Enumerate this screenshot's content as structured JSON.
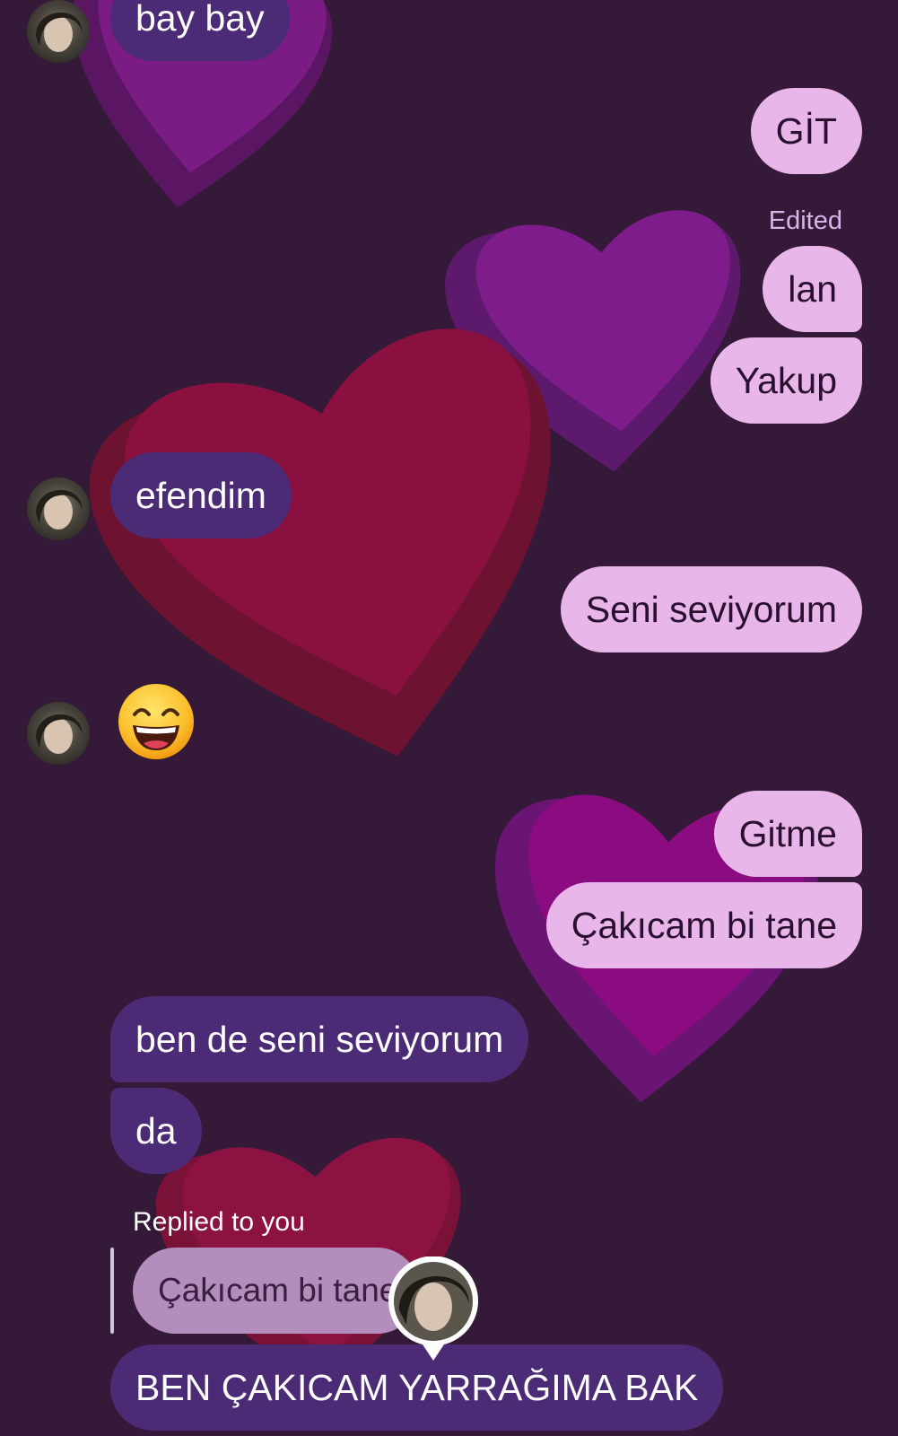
{
  "chat": {
    "messages": [
      {
        "id": "m1",
        "direction": "incoming",
        "text": "bay bay"
      },
      {
        "id": "m2",
        "direction": "outgoing",
        "text": "GİT"
      },
      {
        "id": "m3",
        "direction": "outgoing",
        "text": "lan",
        "edited_label": "Edited"
      },
      {
        "id": "m4",
        "direction": "outgoing",
        "text": "Yakup"
      },
      {
        "id": "m5",
        "direction": "incoming",
        "text": "efendim"
      },
      {
        "id": "m6",
        "direction": "outgoing",
        "text": "Seni seviyorum"
      },
      {
        "id": "m7",
        "direction": "incoming",
        "emoji": "grinning-face-with-smiling-eyes"
      },
      {
        "id": "m8",
        "direction": "outgoing",
        "text": "Gitme"
      },
      {
        "id": "m9",
        "direction": "outgoing",
        "text": "Çakıcam bi tane"
      },
      {
        "id": "m10",
        "direction": "incoming",
        "text": "ben de seni seviyorum"
      },
      {
        "id": "m11",
        "direction": "incoming",
        "text": "da"
      },
      {
        "id": "m12",
        "direction": "incoming",
        "replied_label": "Replied to you",
        "quoted_text": "Çakıcam bi tane",
        "text": "BEN ÇAKICAM YARRAĞIMA BAK"
      }
    ]
  },
  "colors": {
    "background": "#341a38",
    "incoming_bubble": "#4b2a76",
    "outgoing_bubble": "#e9b6e9",
    "outgoing_text": "#2a1030",
    "edited_text": "#d6b4e8",
    "heart_purple": "#7a1a80",
    "heart_red": "#8a1040"
  }
}
